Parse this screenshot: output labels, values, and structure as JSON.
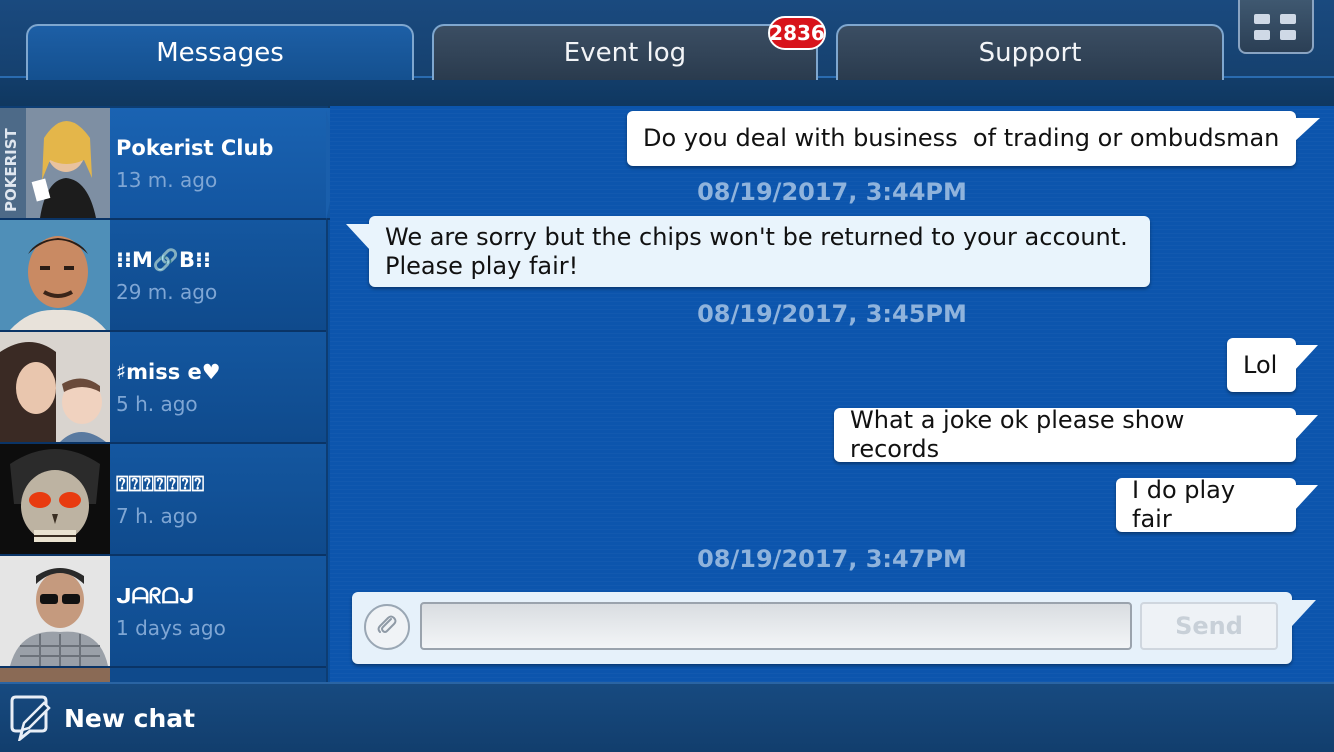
{
  "tabs": [
    {
      "label": "Messages",
      "active": true
    },
    {
      "label": "Event log",
      "active": false,
      "badge": "2836"
    },
    {
      "label": "Support",
      "active": false
    }
  ],
  "contacts": [
    {
      "name": "Pokerist Club",
      "time": "13 m. ago",
      "avatar_text": "POKERIST"
    },
    {
      "name": "⁝⁝M🔗B⁝⁝",
      "time": "29 m. ago"
    },
    {
      "name": "♯miss e♥",
      "time": "5 h. ago"
    },
    {
      "name": "⍰⍰⍰⍰⍰⍰⍰",
      "time": "7 h. ago"
    },
    {
      "name": "ᒍᗩᖇᗝᒍ",
      "time": "1 days ago"
    }
  ],
  "messages": [
    {
      "text": "Do you deal with business  of trading or ombudsman",
      "direction": "outgoing"
    },
    {
      "stamp": "08/19/2017, 3:44PM"
    },
    {
      "text_lines": [
        "We are sorry but the chips won't be returned to your account.",
        "Please play fair!"
      ],
      "direction": "incoming"
    },
    {
      "stamp": "08/19/2017, 3:45PM"
    },
    {
      "text": "Lol",
      "direction": "outgoing"
    },
    {
      "text": "What a joke ok please show records",
      "direction": "outgoing"
    },
    {
      "text": "I do play fair",
      "direction": "outgoing"
    },
    {
      "stamp": "08/19/2017, 3:47PM"
    }
  ],
  "composer": {
    "input_value": "",
    "placeholder": "",
    "send_label": "Send"
  },
  "footer": {
    "new_chat_label": "New chat"
  },
  "colors": {
    "accent": "#0c55ad",
    "badge": "#d8141b",
    "timestamp": "#8fb3dc"
  },
  "icons": {
    "attach": "paperclip-icon",
    "new_chat": "compose-icon",
    "menu": "grid-menu-icon"
  }
}
